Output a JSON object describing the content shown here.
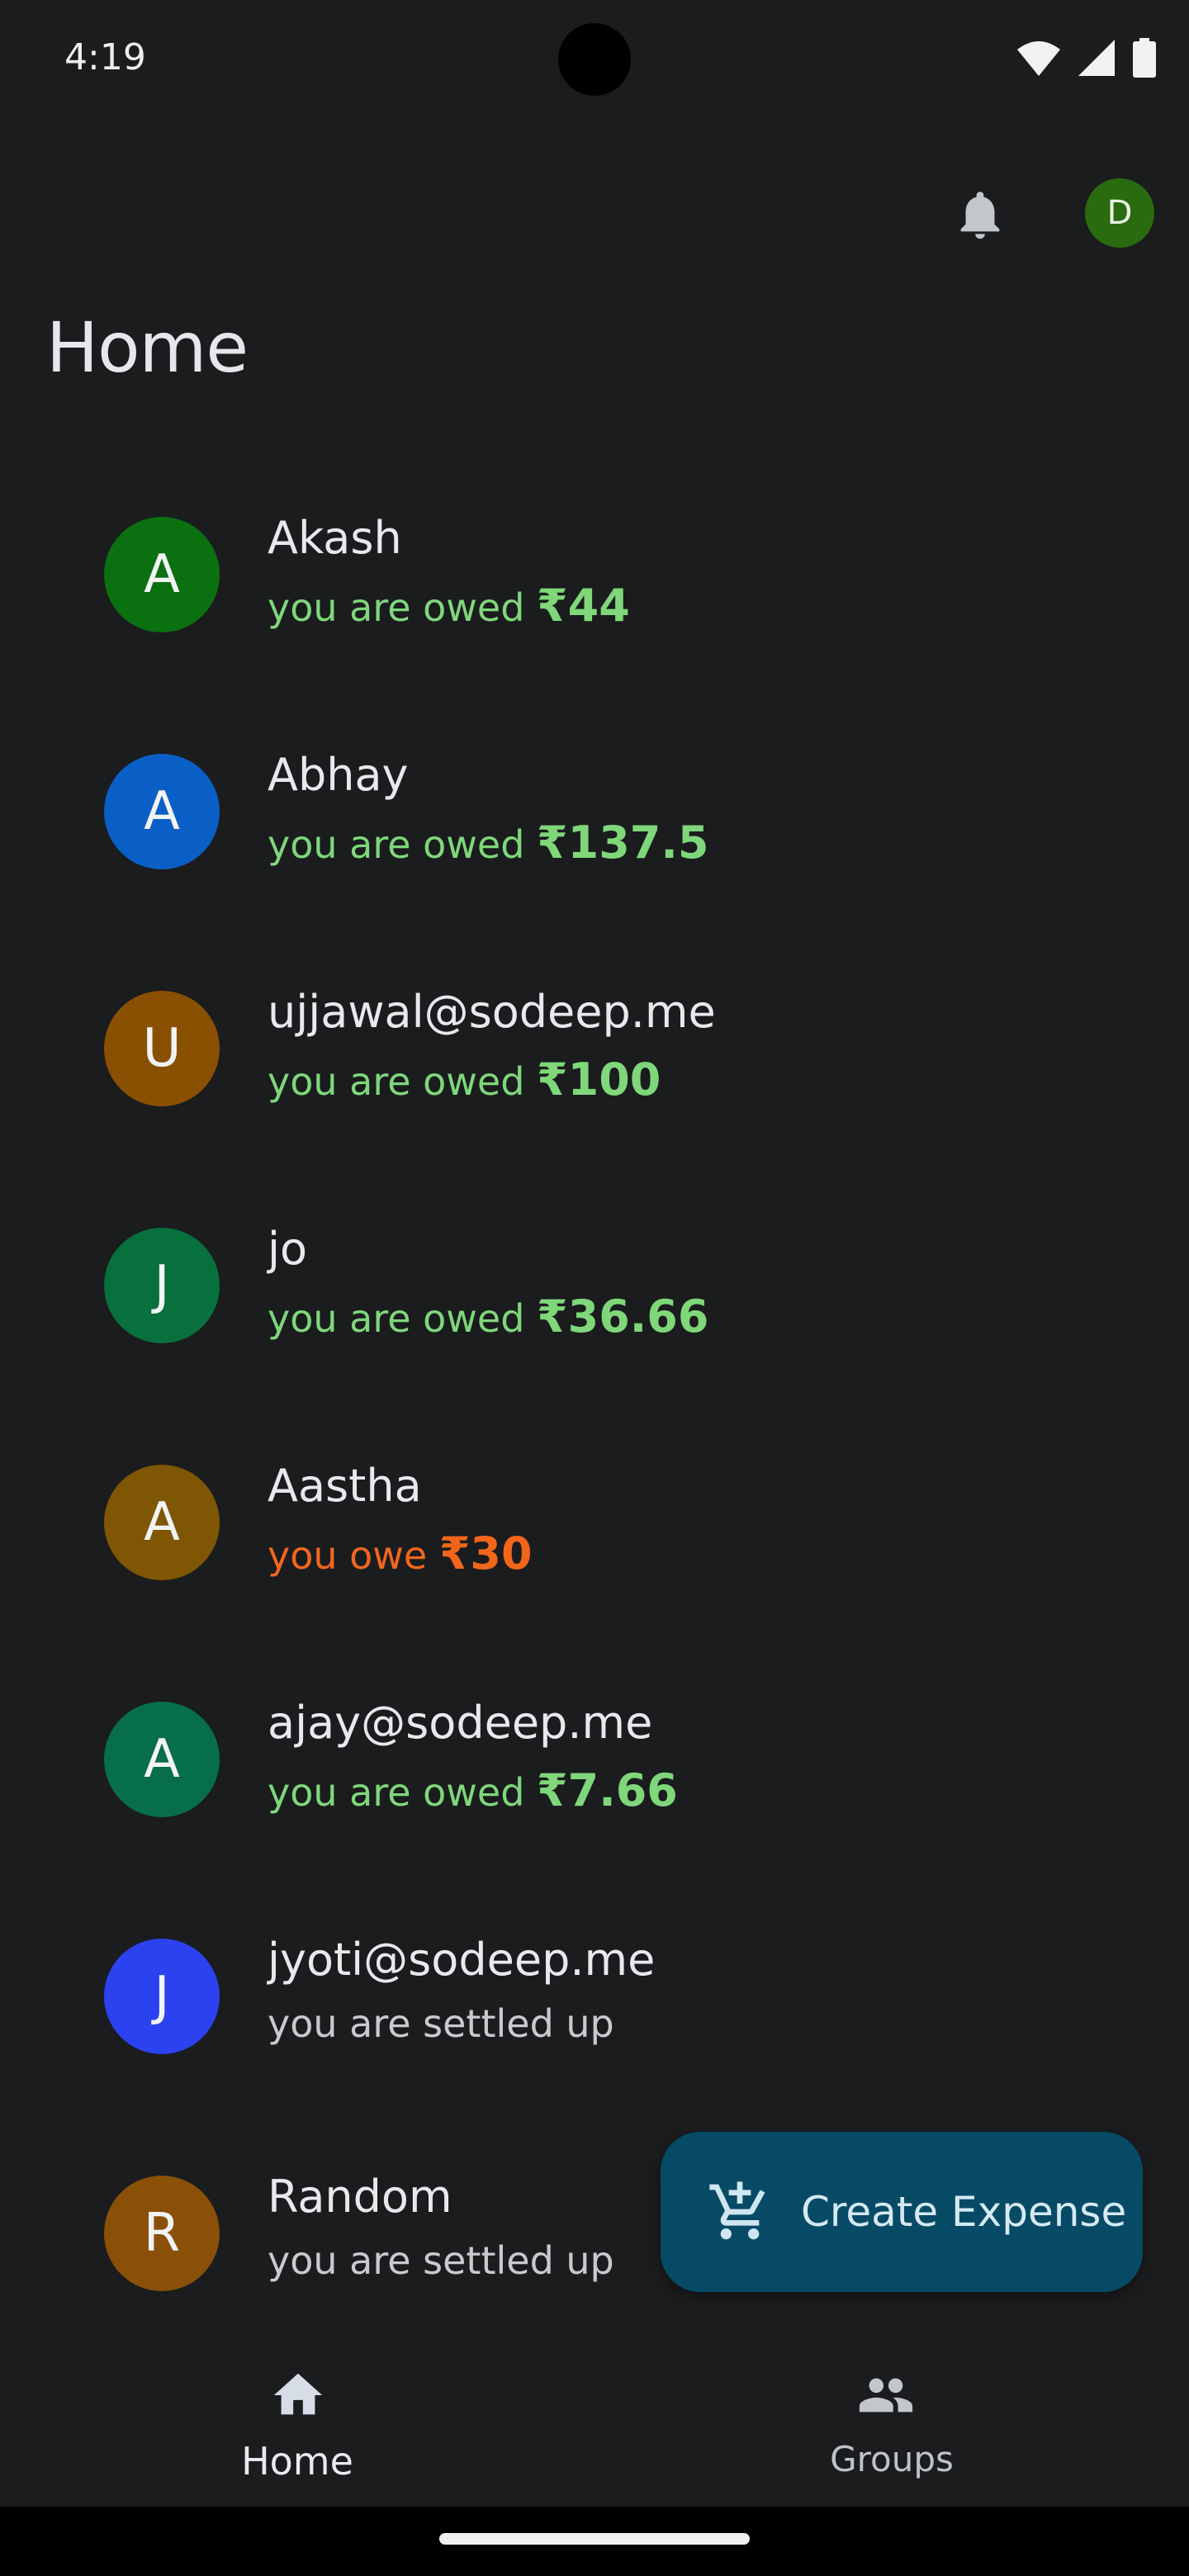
{
  "status_bar": {
    "time": "4:19",
    "icons": [
      "wifi-icon",
      "signal-icon",
      "battery-icon"
    ]
  },
  "top_bar": {
    "notification_icon": "bell-icon",
    "profile_initial": "D",
    "profile_color": "#2a6b0f"
  },
  "page": {
    "title": "Home"
  },
  "friends": [
    {
      "initial": "A",
      "name": "Akash",
      "status": "you are owed",
      "amount": "₹44",
      "type": "owed",
      "color": "#0a7010"
    },
    {
      "initial": "A",
      "name": "Abhay",
      "status": "you are owed",
      "amount": "₹137.5",
      "type": "owed",
      "color": "#0a5fc7"
    },
    {
      "initial": "U",
      "name": "ujjawal@sodeep.me",
      "status": "you are owed",
      "amount": "₹100",
      "type": "owed",
      "color": "#8a5002"
    },
    {
      "initial": "J",
      "name": "jo",
      "status": "you are owed",
      "amount": "₹36.66",
      "type": "owed",
      "color": "#08703c"
    },
    {
      "initial": "A",
      "name": "Aastha",
      "status": "you owe",
      "amount": "₹30",
      "type": "owe",
      "color": "#7e5604"
    },
    {
      "initial": "A",
      "name": "ajay@sodeep.me",
      "status": "you are owed",
      "amount": "₹7.66",
      "type": "owed",
      "color": "#076e4a"
    },
    {
      "initial": "J",
      "name": "jyoti@sodeep.me",
      "status": "you are settled up",
      "amount": "",
      "type": "settled",
      "color": "#2c42f0"
    },
    {
      "initial": "R",
      "name": "Random",
      "status": "you are settled up",
      "amount": "",
      "type": "settled",
      "color": "#8a5008"
    }
  ],
  "fab": {
    "label": "Create Expense",
    "icon": "add-shopping-cart-icon",
    "color": "#064a66"
  },
  "bottom_nav": {
    "home_label": "Home",
    "groups_label": "Groups",
    "home_icon": "home-icon",
    "groups_icon": "group-icon"
  },
  "colors": {
    "background": "#1a1c1e",
    "owed": "#7fd77a",
    "owe": "#f2661c",
    "settled": "#c8cacd"
  }
}
